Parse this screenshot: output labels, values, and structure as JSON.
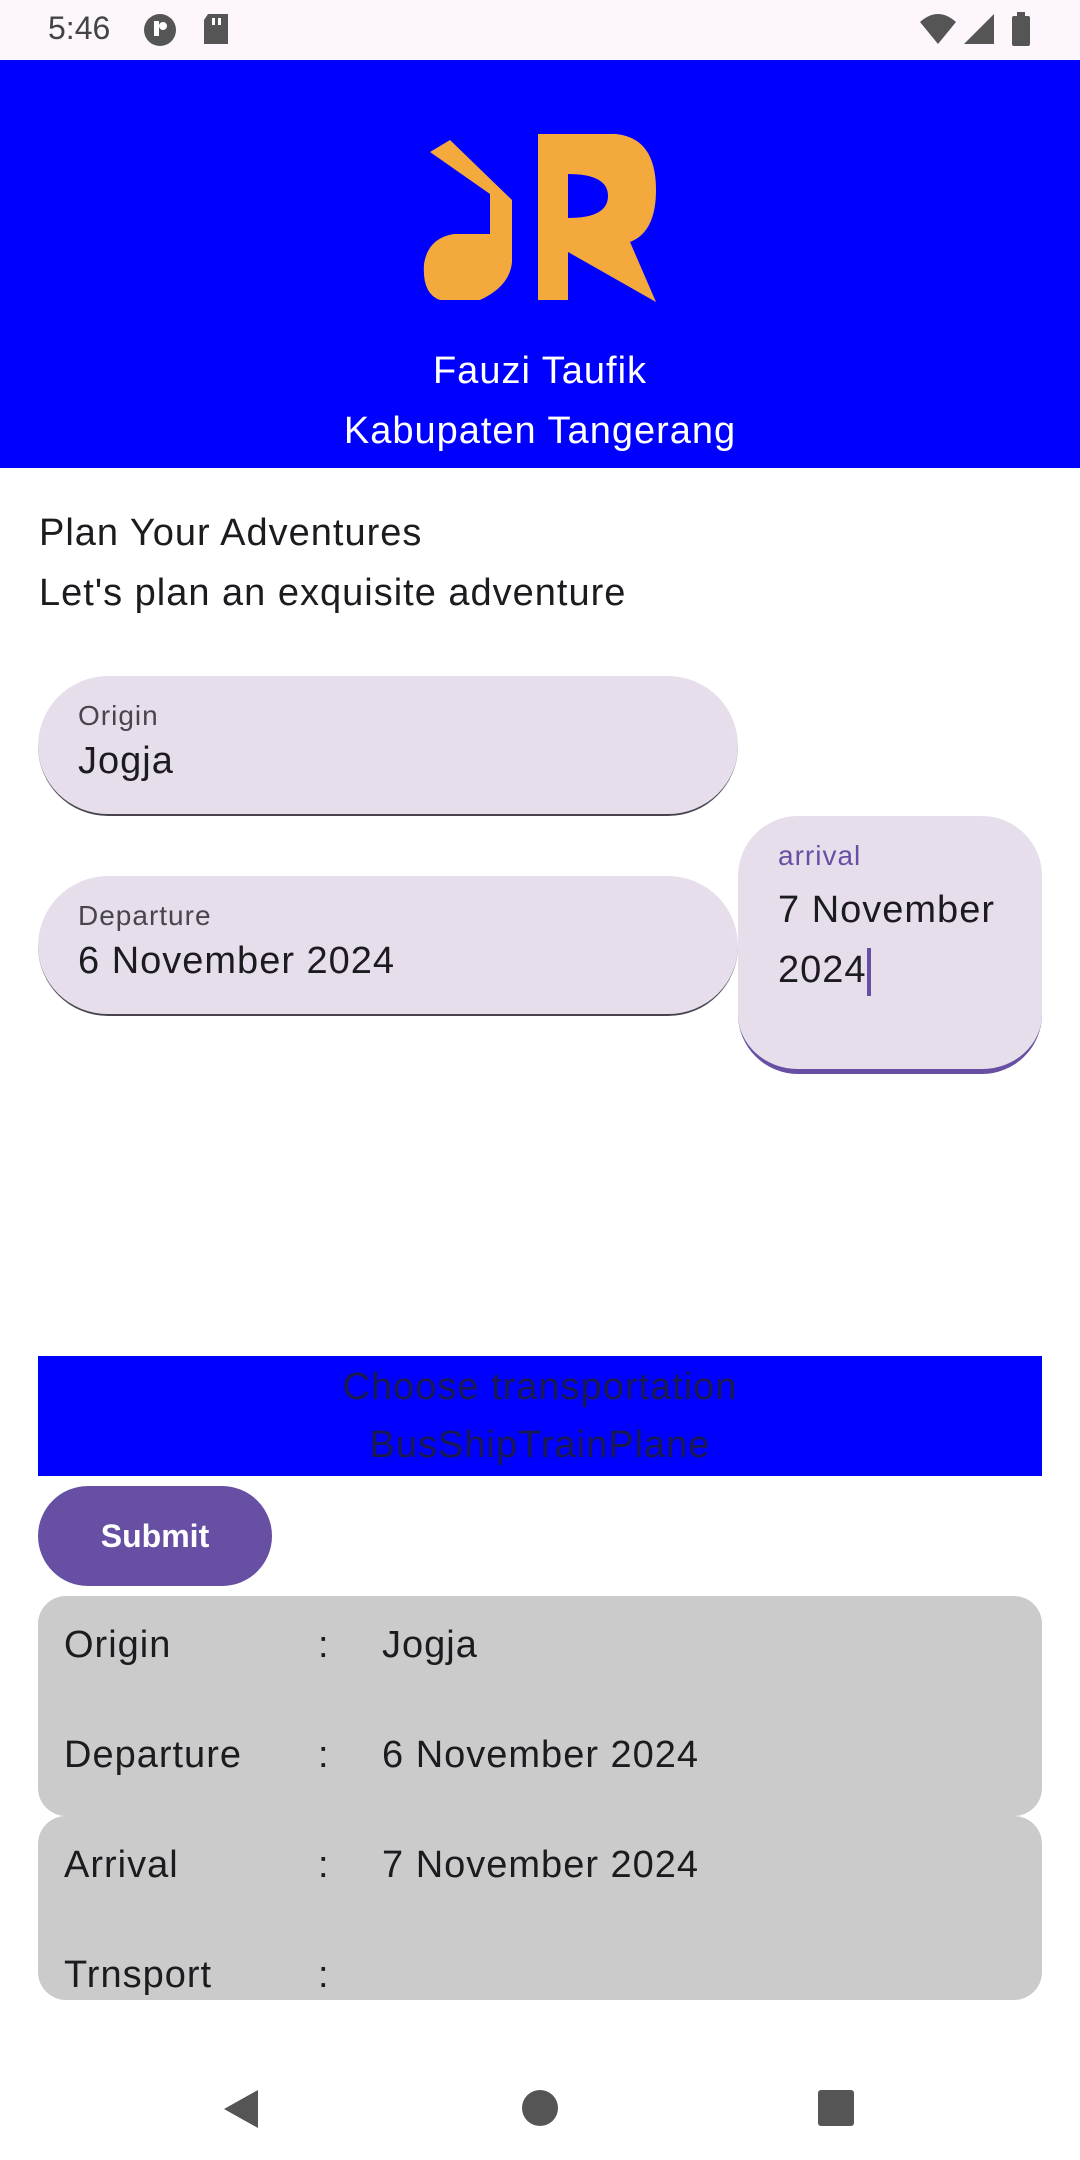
{
  "status_bar": {
    "time": "5:46"
  },
  "header": {
    "name": "Fauzi Taufik",
    "city": "Kabupaten Tangerang"
  },
  "intro": {
    "title": "Plan Your Adventures",
    "subtitle": "Let's plan an exquisite adventure"
  },
  "form": {
    "origin": {
      "label": "Origin",
      "value": "Jogja"
    },
    "departure": {
      "label": "Departure",
      "value": "6 November 2024"
    },
    "arrival": {
      "label": "arrival",
      "value": "7 November 2024"
    }
  },
  "transport": {
    "title": "Choose transportation",
    "options_text": "BusShipTrainPlane"
  },
  "submit_label": "Submit",
  "summary": {
    "separator": ":",
    "origin": {
      "key": "Origin",
      "value": "Jogja"
    },
    "departure": {
      "key": "Departure",
      "value": "6 November 2024"
    },
    "arrival": {
      "key": "Arrival",
      "value": "7 November 2024"
    },
    "transport": {
      "key": "Trnsport",
      "value": ""
    }
  },
  "colors": {
    "header_bg": "#0000ff",
    "logo": "#f4a93c",
    "accent": "#6750a4",
    "field_bg": "#e6dfeb",
    "card_bg": "#cbcbcb"
  },
  "icons": [
    "message-icon",
    "sd-card-icon",
    "wifi-icon",
    "signal-icon",
    "battery-icon",
    "back-icon",
    "home-icon",
    "recents-icon"
  ]
}
